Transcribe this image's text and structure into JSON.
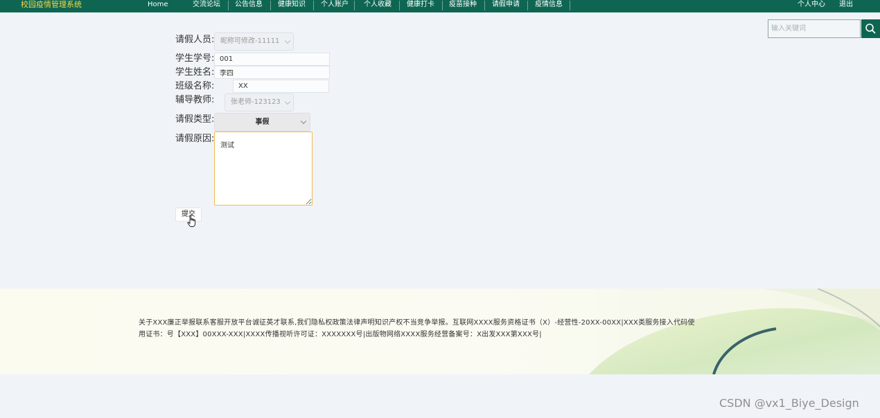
{
  "header": {
    "brand": "校园疫情管理系统",
    "nav": [
      "Home",
      "交流论坛",
      "公告信息",
      "健康知识",
      "个人账户",
      "个人收藏",
      "健康打卡",
      "疫苗接种",
      "请假申请",
      "疫情信息"
    ],
    "user_center": "个人中心",
    "logout": "退出"
  },
  "search": {
    "placeholder": "输入关键词",
    "icon": "search-icon"
  },
  "form": {
    "leave_person_label": "请假人员:",
    "leave_person_value": "昵称可修改-11111",
    "student_id_label": "学生学号:",
    "student_id_value": "001",
    "student_name_label": "学生姓名:",
    "student_name_value": "李四",
    "class_label": "班级名称:",
    "class_value": "XX",
    "teacher_label": "辅导教师:",
    "teacher_value": "张老师-123123",
    "leave_type_label": "请假类型:",
    "leave_type_value": "事假",
    "reason_label": "请假原因:",
    "reason_value": "测试",
    "submit": "提交"
  },
  "footer": {
    "text": "关于XXX廉正举报联系客服开放平台诚征英才联系,我们隐私权政策法律声明知识产权不当竞争举报。互联网XXXX服务资格证书（X）-经营性-20XX-00XX|XXX类服务接入代码使用证书：号【XXX】00XXX-XXX|XXXX传播视听许可证：XXXXXXX号|出版物网络XXXX服务经营备案号：X出发XXX第XXX号|"
  },
  "watermark": "CSDN @vx1_Biye_Design",
  "colors": {
    "header_bg": "#0e6652",
    "brand": "#f3d64a",
    "focus_border": "#f0b94a"
  }
}
